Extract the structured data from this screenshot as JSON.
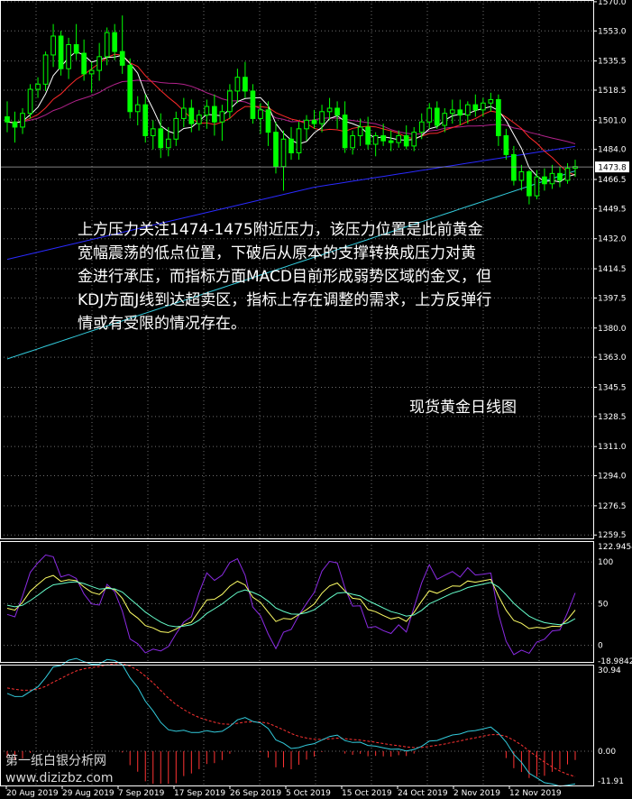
{
  "chart_data": [
    {
      "type": "candlestick",
      "panel": "price",
      "title": "现货黄金日线图",
      "current_price": 1473.8,
      "y_ticks": [
        1570.0,
        1553.0,
        1535.5,
        1518.5,
        1501.0,
        1484.0,
        1466.5,
        1449.5,
        1432.0,
        1414.5,
        1397.5,
        1380.0,
        1363.0,
        1345.5,
        1328.5,
        1311.0,
        1294.0,
        1276.5,
        1259.5
      ],
      "ylim": [
        1257.0,
        1571.0
      ],
      "x_labels": [
        "20 Aug 2019",
        "29 Aug 2019",
        "7 Sep 2019",
        "17 Sep 2019",
        "26 Sep 2019",
        "5 Oct 2019",
        "15 Oct 2019",
        "24 Oct 2019",
        "2 Nov 2019",
        "12 Nov 2019"
      ],
      "ohlc": [
        [
          1503,
          1512,
          1494,
          1500
        ],
        [
          1500,
          1506,
          1488,
          1497
        ],
        [
          1497,
          1508,
          1493,
          1505
        ],
        [
          1505,
          1522,
          1502,
          1519
        ],
        [
          1519,
          1526,
          1514,
          1522
        ],
        [
          1522,
          1541,
          1518,
          1539
        ],
        [
          1539,
          1557,
          1532,
          1550
        ],
        [
          1550,
          1553,
          1527,
          1531
        ],
        [
          1531,
          1549,
          1525,
          1545
        ],
        [
          1545,
          1557,
          1536,
          1540
        ],
        [
          1540,
          1548,
          1524,
          1528
        ],
        [
          1528,
          1535,
          1517,
          1530
        ],
        [
          1530,
          1546,
          1524,
          1538
        ],
        [
          1538,
          1555,
          1533,
          1552
        ],
        [
          1552,
          1557,
          1536,
          1541
        ],
        [
          1541,
          1562,
          1528,
          1533
        ],
        [
          1533,
          1537,
          1502,
          1506
        ],
        [
          1506,
          1515,
          1498,
          1510
        ],
        [
          1510,
          1516,
          1488,
          1492
        ],
        [
          1492,
          1501,
          1484,
          1496
        ],
        [
          1496,
          1505,
          1479,
          1485
        ],
        [
          1485,
          1497,
          1480,
          1490
        ],
        [
          1490,
          1506,
          1486,
          1502
        ],
        [
          1502,
          1514,
          1497,
          1508
        ],
        [
          1508,
          1513,
          1494,
          1499
        ],
        [
          1499,
          1507,
          1495,
          1504
        ],
        [
          1504,
          1513,
          1496,
          1509
        ],
        [
          1509,
          1516,
          1492,
          1500
        ],
        [
          1500,
          1510,
          1489,
          1506
        ],
        [
          1506,
          1522,
          1502,
          1518
        ],
        [
          1518,
          1531,
          1511,
          1526
        ],
        [
          1526,
          1535,
          1514,
          1518
        ],
        [
          1518,
          1522,
          1499,
          1502
        ],
        [
          1502,
          1511,
          1493,
          1507
        ],
        [
          1507,
          1512,
          1486,
          1494
        ],
        [
          1494,
          1500,
          1470,
          1474
        ],
        [
          1474,
          1495,
          1460,
          1490
        ],
        [
          1490,
          1497,
          1478,
          1482
        ],
        [
          1482,
          1500,
          1478,
          1496
        ],
        [
          1496,
          1504,
          1489,
          1501
        ],
        [
          1501,
          1507,
          1496,
          1499
        ],
        [
          1499,
          1510,
          1494,
          1506
        ],
        [
          1506,
          1514,
          1501,
          1508
        ],
        [
          1508,
          1512,
          1496,
          1504
        ],
        [
          1504,
          1512,
          1482,
          1485
        ],
        [
          1485,
          1495,
          1481,
          1492
        ],
        [
          1492,
          1502,
          1486,
          1497
        ],
        [
          1497,
          1503,
          1484,
          1487
        ],
        [
          1487,
          1494,
          1480,
          1492
        ],
        [
          1492,
          1499,
          1486,
          1489
        ],
        [
          1489,
          1495,
          1483,
          1488
        ],
        [
          1488,
          1495,
          1485,
          1492
        ],
        [
          1492,
          1498,
          1484,
          1486
        ],
        [
          1486,
          1497,
          1483,
          1494
        ],
        [
          1494,
          1505,
          1490,
          1500
        ],
        [
          1500,
          1511,
          1496,
          1508
        ],
        [
          1508,
          1512,
          1496,
          1498
        ],
        [
          1498,
          1508,
          1494,
          1505
        ],
        [
          1505,
          1513,
          1499,
          1507
        ],
        [
          1507,
          1513,
          1498,
          1504
        ],
        [
          1504,
          1512,
          1499,
          1510
        ],
        [
          1510,
          1516,
          1503,
          1507
        ],
        [
          1507,
          1514,
          1503,
          1511
        ],
        [
          1511,
          1517,
          1506,
          1513
        ],
        [
          1513,
          1516,
          1486,
          1492
        ],
        [
          1492,
          1496,
          1478,
          1481
        ],
        [
          1481,
          1486,
          1463,
          1466
        ],
        [
          1466,
          1475,
          1460,
          1471
        ],
        [
          1471,
          1472,
          1452,
          1457
        ],
        [
          1457,
          1472,
          1455,
          1468
        ],
        [
          1468,
          1473,
          1460,
          1464
        ],
        [
          1464,
          1475,
          1461,
          1470
        ],
        [
          1470,
          1474,
          1462,
          1466
        ],
        [
          1466,
          1476,
          1464,
          1473
        ],
        [
          1473,
          1478,
          1468,
          1474
        ]
      ]
    },
    {
      "type": "line",
      "panel": "kdj",
      "y_ticks": [
        122.9454,
        100,
        50,
        0,
        -18.9842
      ],
      "ylim": [
        -21,
        125
      ]
    },
    {
      "type": "macd",
      "panel": "macd",
      "y_ticks": [
        30.94,
        0.0,
        -11.91
      ],
      "ylim": [
        -13,
        32
      ]
    }
  ],
  "annotation": {
    "lines": [
      "上方压力关注1474-1475附近压力，该压力位置是此前黄金",
      "宽幅震荡的低点位置，下破后从原本的支撑转换成压力对黄",
      "金进行承压，而指标方面MACD目前形成弱势区域的金叉，但",
      "KDJ方面J线到达超卖区，指标上存在调整的需求，上方反弹行",
      "情或有受限的情况存在。"
    ]
  },
  "watermark": {
    "line1": "第一纸白银分析网",
    "line2": "www.dizizbz.com"
  },
  "colors": {
    "background": "#000000",
    "up": "#00ff00",
    "grid": "#6e6e6e",
    "frame": "#ffffff",
    "ma_fast": "#ffffff",
    "ma_mid": "#ff2a2a",
    "ma_slow": "#b2228b",
    "ma_60": "#2a2aff",
    "ma_120": "#33ccdd",
    "k_line": "#ffff66",
    "d_line": "#66ffcc",
    "j_line": "#8a2be2",
    "signal": "#ff3333",
    "macd_line": "#33ccdd",
    "hist_neg": "#ff3333"
  }
}
